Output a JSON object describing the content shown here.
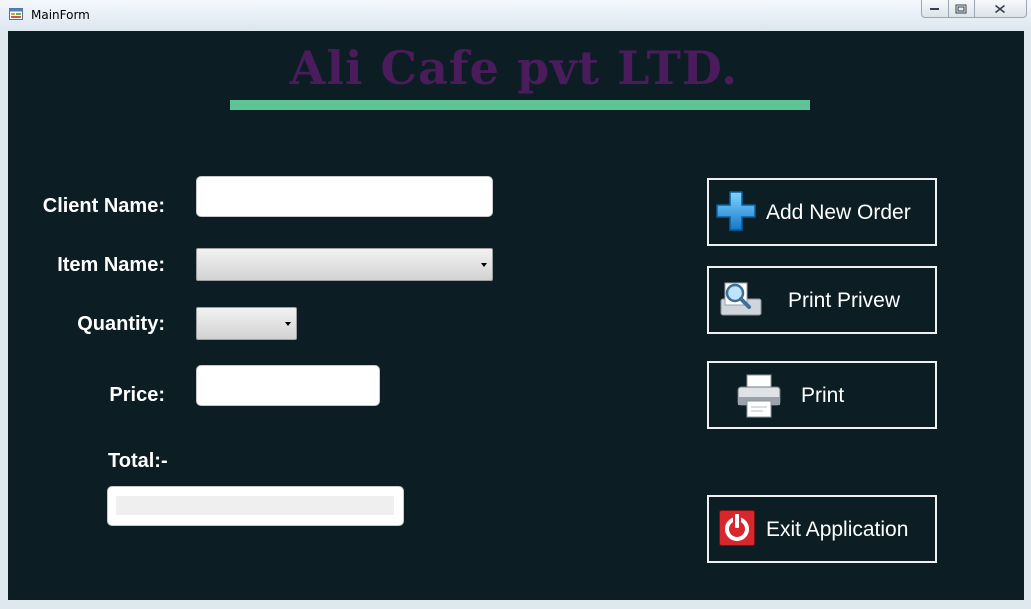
{
  "window": {
    "title": "MainForm"
  },
  "header": {
    "brand": "Ali Cafe pvt LTD."
  },
  "form": {
    "client_name_label": "Client Name:",
    "client_name_value": "",
    "item_name_label": "Item Name:",
    "item_name_value": "",
    "quantity_label": "Quantity:",
    "quantity_value": "",
    "price_label": "Price:",
    "price_value": "",
    "total_label": "Total:-",
    "total_value": ""
  },
  "actions": {
    "add_new_order": "Add New Order",
    "print_preview": "Print Privew",
    "print": "Print",
    "exit": "Exit Application"
  },
  "icons": {
    "app": "app-form-icon",
    "add": "plus-icon",
    "preview": "magnifier-document-icon",
    "print": "printer-icon",
    "exit": "power-icon"
  },
  "colors": {
    "background": "#0c1d24",
    "brand_text": "#4a1c5c",
    "brand_underline": "#5ec496",
    "button_border": "#f0f0f0"
  }
}
